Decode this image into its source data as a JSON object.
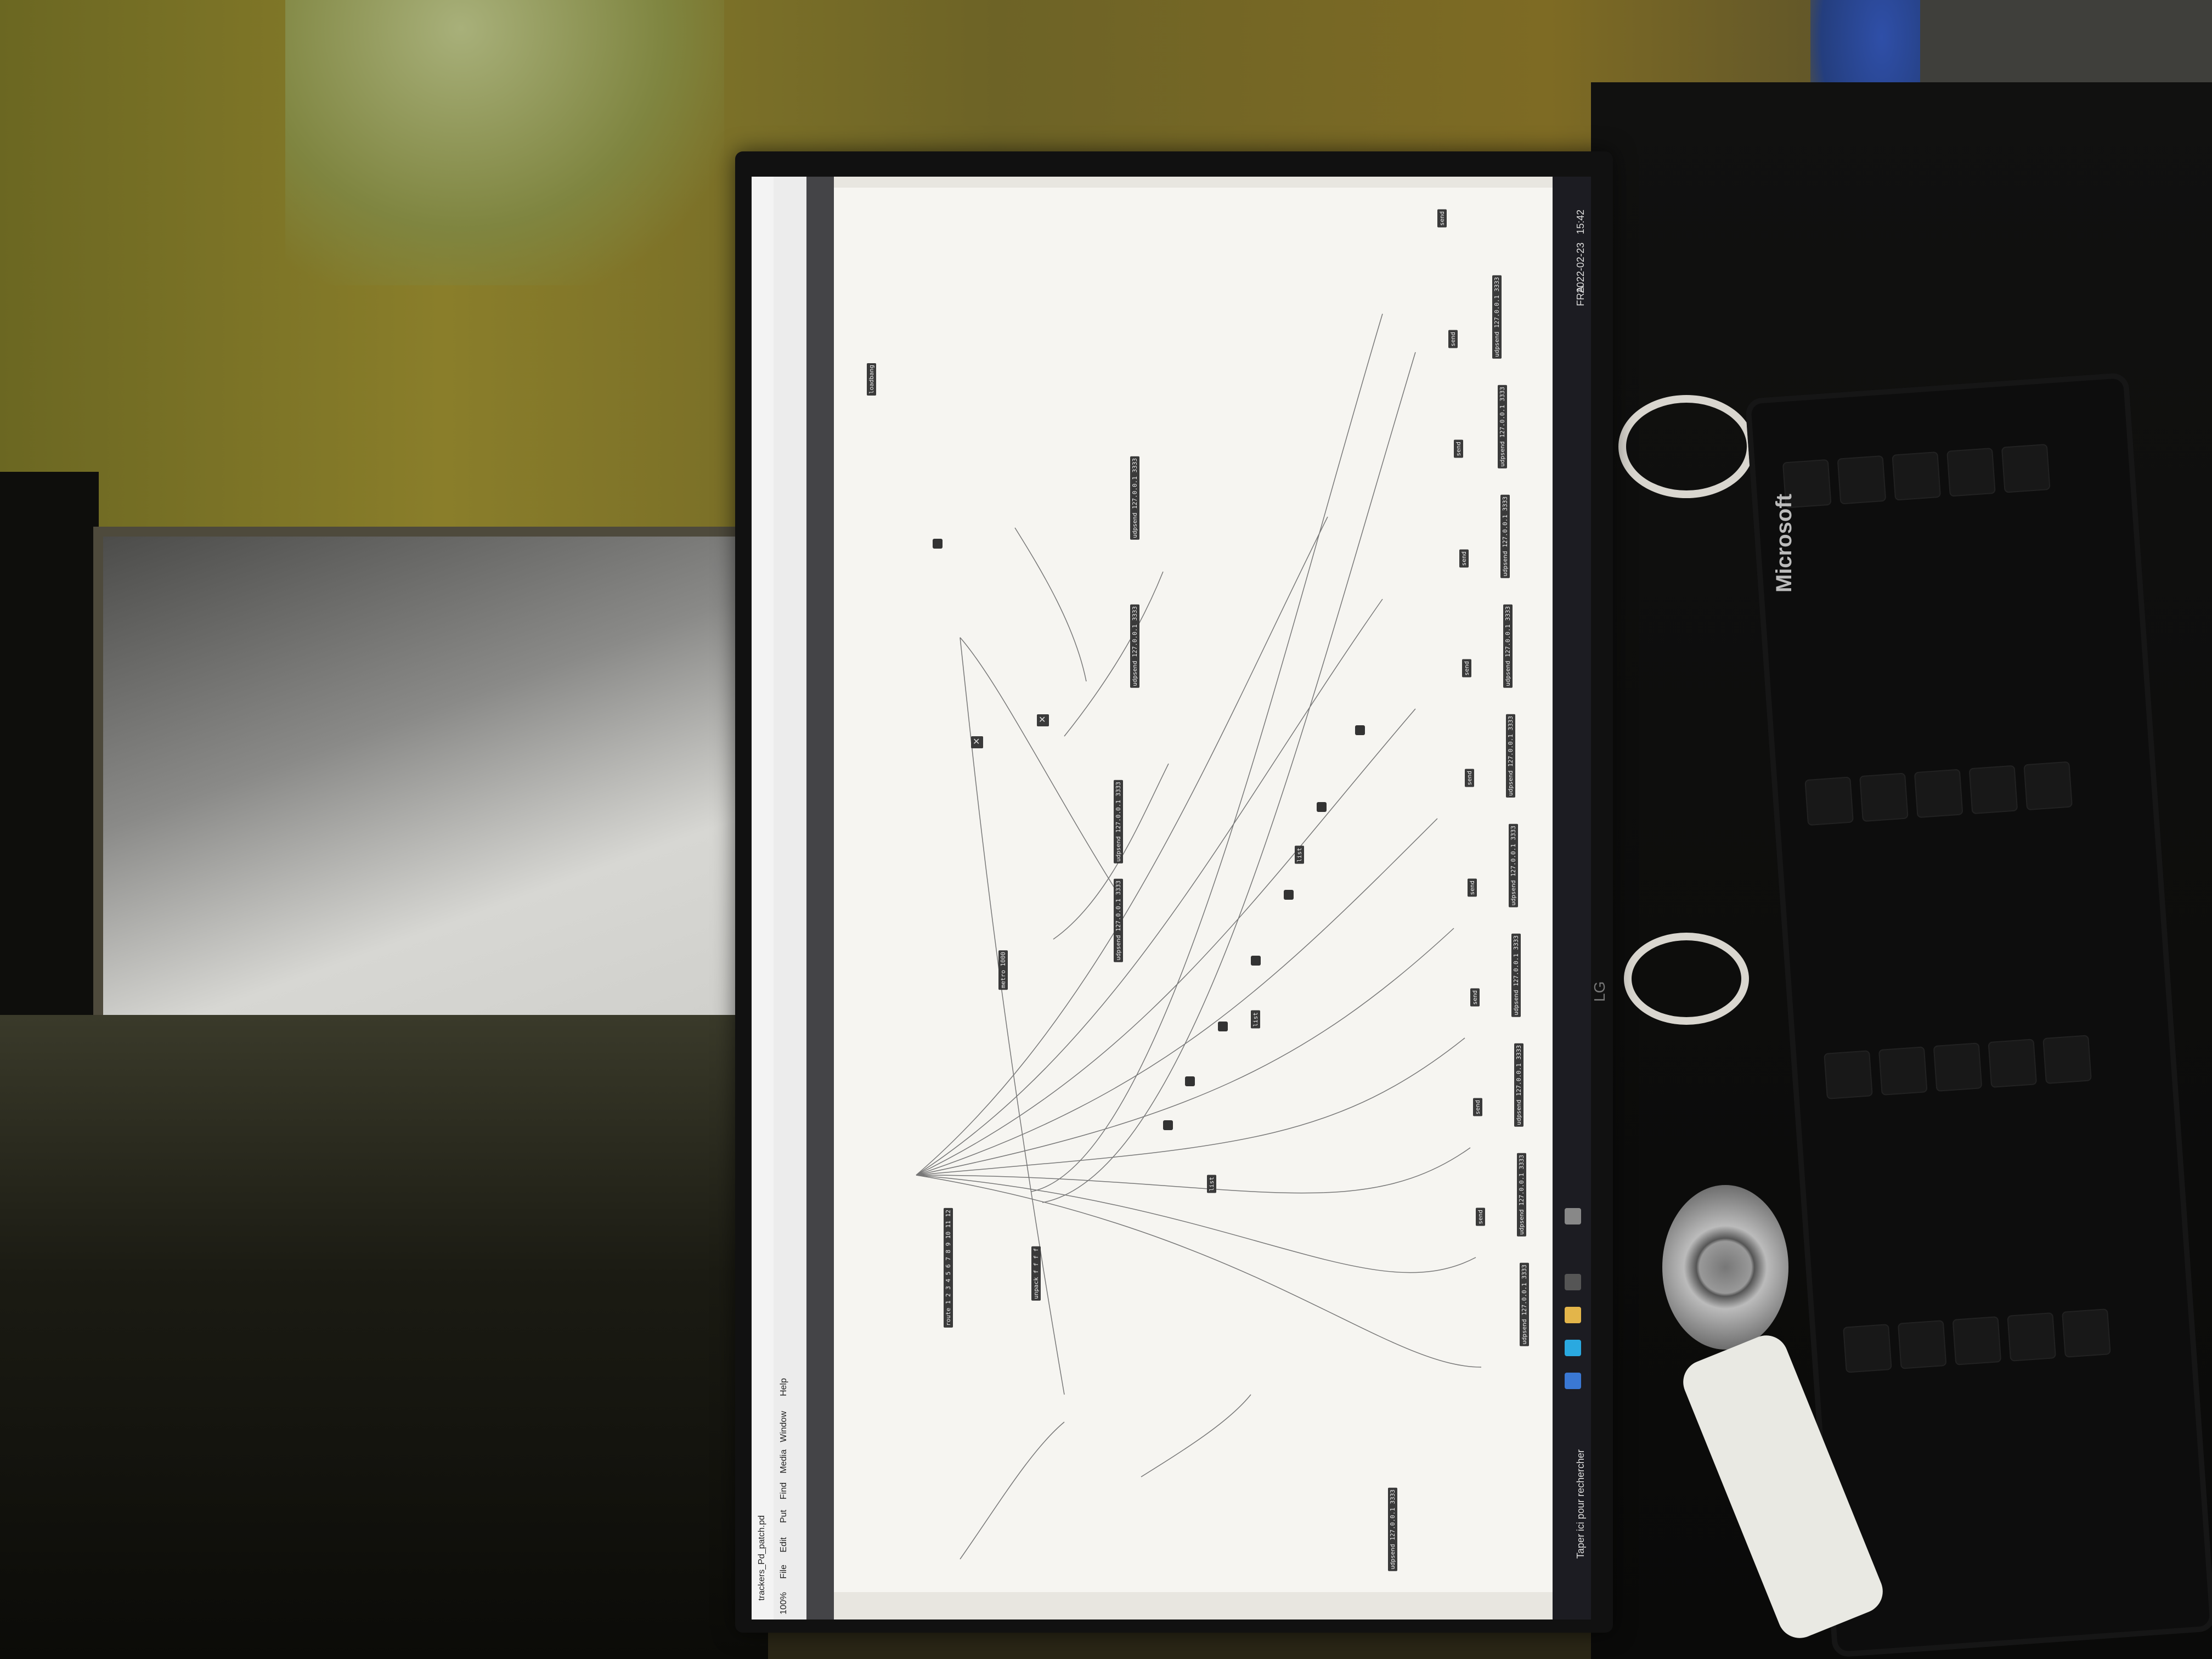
{
  "screen": {
    "window_title": "trackers_Pd_patch.pd",
    "menu": [
      "File",
      "Edit",
      "Put",
      "Find",
      "Media",
      "Window",
      "Help"
    ],
    "zoom": "100%",
    "taskbar": {
      "search_placeholder": "Taper ici pour rechercher",
      "time": "15:42",
      "date": "2022-02-23",
      "language": "FRA"
    }
  },
  "patch_nodes": {
    "udpsend": "udpsend 127.0.0.1 3333",
    "send": "send",
    "list": "list",
    "route": "route 1 2 3 4 5 6 7 8 9 10 11 12",
    "metro": "metro 1000",
    "loadbang": "loadbang",
    "unpack": "unpack f f f f"
  },
  "monitor": {
    "brand": "LG"
  },
  "keyboard": {
    "brand": "Microsoft"
  },
  "colors": {
    "canvas": "#f6f5f1",
    "node": "#3a3a3a",
    "taskbar": "#1c1c22"
  }
}
